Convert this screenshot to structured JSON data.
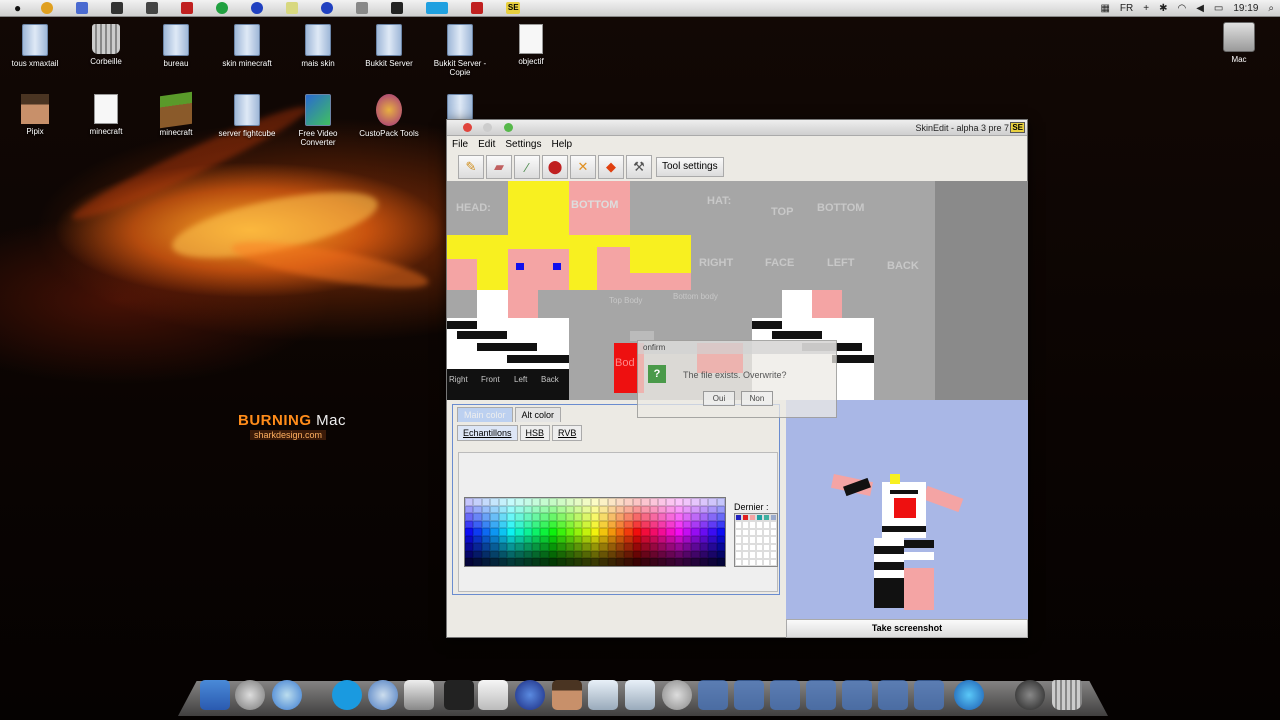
{
  "menubar": {
    "lang": "FR",
    "clock": "19:19",
    "icons": [
      "apple-icon",
      "finder-icon",
      "safari-icon",
      "mail-icon",
      "terminal-icon",
      "photos-icon",
      "app-icon",
      "skype-icon",
      "app-icon",
      "game-icon",
      "se-icon"
    ]
  },
  "desktop": {
    "icons": [
      {
        "label": "tous xmaxtail",
        "kind": "folder"
      },
      {
        "label": "Corbeille",
        "kind": "trash"
      },
      {
        "label": "bureau",
        "kind": "folder"
      },
      {
        "label": "skin minecraft",
        "kind": "folder"
      },
      {
        "label": "mais skin",
        "kind": "folder"
      },
      {
        "label": "Bukkit Server",
        "kind": "folder"
      },
      {
        "label": "Bukkit Server - Copie",
        "kind": "folder"
      },
      {
        "label": "objectif",
        "kind": "doc"
      },
      {
        "label": "Pipix",
        "kind": "head"
      },
      {
        "label": "minecraft",
        "kind": "doc"
      },
      {
        "label": "minecraft",
        "kind": "grass"
      },
      {
        "label": "server fightcube",
        "kind": "folder"
      },
      {
        "label": "Free Video Converter",
        "kind": "app"
      },
      {
        "label": "CustoPack Tools",
        "kind": "app"
      }
    ],
    "drive_label": "Mac",
    "brand_main": "BURNING",
    "brand_mac": "Mac",
    "brand_sub": "sharkdesign.com"
  },
  "window": {
    "title": "SkinEdit - alpha 3 pre 7",
    "badge": "SE",
    "menus": [
      "File",
      "Edit",
      "Settings",
      "Help"
    ],
    "tool_icons": [
      "pencil-icon",
      "eraser-icon",
      "eyedropper-icon",
      "bucket-icon",
      "replace-icon",
      "brush-icon",
      "hammer-icon"
    ],
    "tool_settings": "Tool settings",
    "canvas_labels": {
      "head": "HEAD:",
      "bottom": "BOTTOM",
      "hat": "HAT:",
      "top": "TOP",
      "bottom2": "BOTTOM",
      "right": "RIGHT",
      "face": "FACE",
      "left": "LEFT",
      "back": "BACK",
      "top_body": "Top Body",
      "bottom_body": "Bottom body",
      "right2": "Right",
      "front": "Front",
      "left2": "Left",
      "back2": "Back",
      "body": "Bod"
    },
    "color_tabs": [
      "Main color",
      "Alt color"
    ],
    "sub_tabs": [
      "Echantillons",
      "HSB",
      "RVB"
    ],
    "recent_label": "Dernier :",
    "screenshot_button": "Take screenshot"
  },
  "dialog": {
    "title": "onfirm",
    "message": "The file exists. Overwrite?",
    "yes": "Oui",
    "no": "Non"
  },
  "colors": {
    "skin": "#f4a4a4",
    "yellow": "#f8f020",
    "red": "#ee1010",
    "preview_bg": "#a9b7e6"
  }
}
